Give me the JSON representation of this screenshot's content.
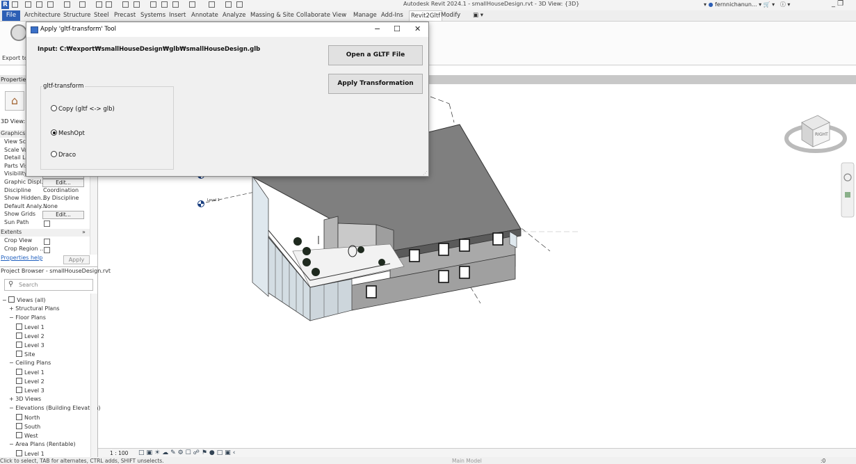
{
  "app": {
    "title": "Autodesk Revit 2024.1 - smallHouseDesign.rvt - 3D View: {3D}",
    "user": "fernnichanun...",
    "logo": "R"
  },
  "menu": [
    "File",
    "Architecture",
    "Structure",
    "Steel",
    "Precast",
    "Systems",
    "Insert",
    "Annotate",
    "Analyze",
    "Massing & Site",
    "Collaborate",
    "View",
    "Manage",
    "Add-Ins",
    "Revit2Gltf",
    "Modify"
  ],
  "menu_active": "Revit2Gltf",
  "ribbon": {
    "export_label": "Export to"
  },
  "properties": {
    "title": "Properties",
    "view_type": "3D View:",
    "graphics_section": "Graphics",
    "rows": [
      {
        "k": "View Sca",
        "v": ""
      },
      {
        "k": "Scale Val",
        "v": ""
      },
      {
        "k": "Detail Le",
        "v": ""
      },
      {
        "k": "Parts Visi",
        "v": ""
      },
      {
        "k": "Visibility/...",
        "v": "Edit..."
      },
      {
        "k": "Graphic Displ...",
        "v": "Edit..."
      },
      {
        "k": "Discipline",
        "v": "Coordination"
      },
      {
        "k": "Show Hidden...",
        "v": "By Discipline"
      },
      {
        "k": "Default Analy...",
        "v": "None"
      },
      {
        "k": "Show Grids",
        "v": "Edit..."
      },
      {
        "k": "Sun Path",
        "v": ""
      }
    ],
    "extents_section": "Extents",
    "extents_rows": [
      {
        "k": "Crop View",
        "v": ""
      },
      {
        "k": "Crop Region ...",
        "v": ""
      }
    ],
    "help_link": "Properties help",
    "apply": "Apply"
  },
  "project_browser": {
    "title": "Project Browser - smallHouseDesign.rvt",
    "search_placeholder": "Search",
    "items": [
      {
        "label": "Views (all)",
        "level": 0,
        "toggle": "−"
      },
      {
        "label": "Structural Plans",
        "level": 1,
        "toggle": "+"
      },
      {
        "label": "Floor Plans",
        "level": 1,
        "toggle": "−"
      },
      {
        "label": "Level 1",
        "level": 2,
        "toggle": ""
      },
      {
        "label": "Level 2",
        "level": 2,
        "toggle": ""
      },
      {
        "label": "Level 3",
        "level": 2,
        "toggle": ""
      },
      {
        "label": "Site",
        "level": 2,
        "toggle": ""
      },
      {
        "label": "Ceiling Plans",
        "level": 1,
        "toggle": "−"
      },
      {
        "label": "Level 1",
        "level": 2,
        "toggle": ""
      },
      {
        "label": "Level 2",
        "level": 2,
        "toggle": ""
      },
      {
        "label": "Level 3",
        "level": 2,
        "toggle": ""
      },
      {
        "label": "3D Views",
        "level": 1,
        "toggle": "+"
      },
      {
        "label": "Elevations (Building Elevation)",
        "level": 1,
        "toggle": "−"
      },
      {
        "label": "North",
        "level": 2,
        "toggle": ""
      },
      {
        "label": "South",
        "level": 2,
        "toggle": ""
      },
      {
        "label": "West",
        "level": 2,
        "toggle": ""
      },
      {
        "label": "Area Plans (Rentable)",
        "level": 1,
        "toggle": "−"
      },
      {
        "label": "Level 1",
        "level": 2,
        "toggle": ""
      }
    ]
  },
  "viewport": {
    "level_label_1": "Level 1",
    "viewcube_face": "RIGHT"
  },
  "view_control": {
    "scale": "1 : 100",
    "model": "Main Model"
  },
  "status": {
    "text": "Click to select, TAB for alternates, CTRL adds, SHIFT unselects.",
    "count": ":0"
  },
  "dialog": {
    "title": "Apply 'gltf-transform' Tool",
    "input_label": "Input: C:₩export₩smallHouseDesign₩glb₩smallHouseDesign.glb",
    "open_button": "Open a GLTF File",
    "apply_button": "Apply Transformation",
    "group_label": "gltf-transform",
    "options": [
      {
        "label": "Copy (gltf <-> glb)",
        "selected": false
      },
      {
        "label": "MeshOpt",
        "selected": true
      },
      {
        "label": "Draco",
        "selected": false
      }
    ],
    "minimize": "−",
    "maximize": "☐",
    "close": "✕"
  }
}
